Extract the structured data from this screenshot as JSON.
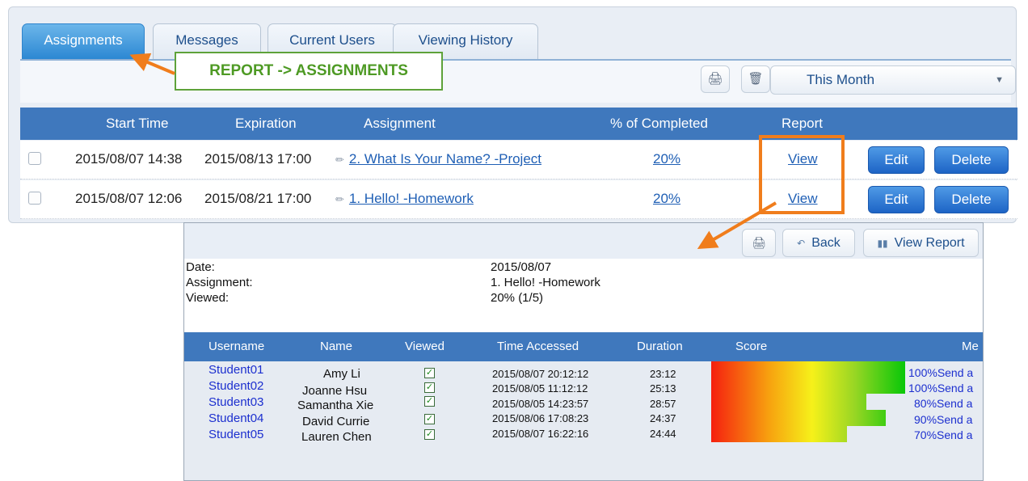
{
  "tabs": [
    {
      "label": "Assignments",
      "active": true
    },
    {
      "label": "Messages",
      "active": false
    },
    {
      "label": "Current Users",
      "active": false
    },
    {
      "label": "Viewing History",
      "active": false
    }
  ],
  "toolbar": {
    "print_icon": "print-icon",
    "delete_icon": "trash-icon",
    "range_value": "This Month"
  },
  "columns": {
    "start": "Start Time",
    "expire": "Expiration",
    "assignment": "Assignment",
    "completed": "% of Completed",
    "report": "Report"
  },
  "assignments": [
    {
      "start": "2015/08/07 14:38",
      "expire": "2015/08/13 17:00",
      "title": "2. What Is Your Name? -Project",
      "completed": "20%",
      "view": "View",
      "edit": "Edit",
      "delete": "Delete"
    },
    {
      "start": "2015/08/07 12:06",
      "expire": "2015/08/21 17:00",
      "title": "1. Hello! -Homework",
      "completed": "20%",
      "view": "View",
      "edit": "Edit",
      "delete": "Delete"
    }
  ],
  "annotation": {
    "callout": "REPORT -> ASSIGNMENTS",
    "arrow_color": "#f07d1c",
    "callout_color": "#4e9a24"
  },
  "report": {
    "toolbar": {
      "print_icon": "print-icon",
      "back": "Back",
      "view_report": "View Report"
    },
    "info": [
      {
        "label": "Date:",
        "value": "2015/08/07"
      },
      {
        "label": "Assignment:",
        "value": "1. Hello! -Homework"
      },
      {
        "label": "Viewed:",
        "value": "20% (1/5)"
      }
    ],
    "columns": {
      "username": "Username",
      "name": "Name",
      "viewed": "Viewed",
      "time": "Time Accessed",
      "duration": "Duration",
      "score": "Score",
      "message": "Me"
    },
    "students": [
      {
        "username": "Student01",
        "name": "Amy Li",
        "viewed": true,
        "time": "2015/08/07 20:12:12",
        "duration": "23:12",
        "score": 100,
        "score_label": "100%",
        "send": "Send a"
      },
      {
        "username": "Student02",
        "name": "Joanne Hsu",
        "viewed": true,
        "time": "2015/08/05 11:12:12",
        "duration": "25:13",
        "score": 100,
        "score_label": "100%",
        "send": "Send a"
      },
      {
        "username": "Student03",
        "name": "Samantha Xie",
        "viewed": true,
        "time": "2015/08/05 14:23:57",
        "duration": "28:57",
        "score": 80,
        "score_label": "80%",
        "send": "Send a"
      },
      {
        "username": "Student04",
        "name": "David Currie",
        "viewed": true,
        "time": "2015/08/06 17:08:23",
        "duration": "24:37",
        "score": 90,
        "score_label": "90%",
        "send": "Send a"
      },
      {
        "username": "Student05",
        "name": "Lauren Chen",
        "viewed": true,
        "time": "2015/08/07 16:22:16",
        "duration": "24:44",
        "score": 70,
        "score_label": "70%",
        "send": "Send a"
      }
    ]
  }
}
